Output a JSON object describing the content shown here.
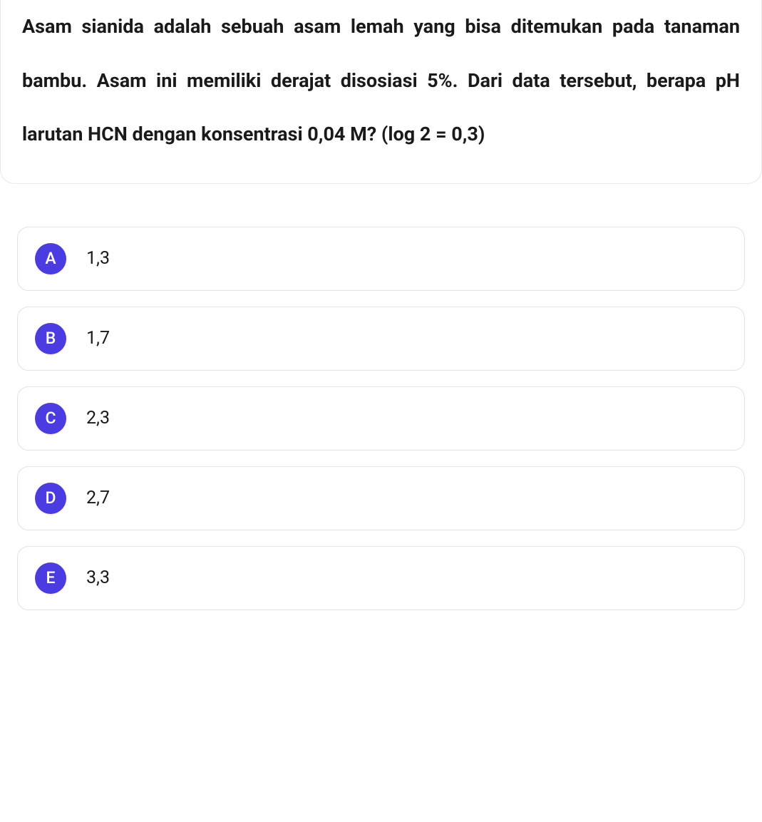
{
  "question": {
    "text": "Asam sianida adalah sebuah asam lemah yang bisa ditemukan pada tanaman bambu. Asam ini memiliki derajat disosiasi 5%. Dari data tersebut, berapa pH larutan HCN dengan konsentrasi 0,04 M? (log 2 = 0,3)"
  },
  "options": [
    {
      "letter": "A",
      "text": "1,3"
    },
    {
      "letter": "B",
      "text": "1,7"
    },
    {
      "letter": "C",
      "text": "2,3"
    },
    {
      "letter": "D",
      "text": "2,7"
    },
    {
      "letter": "E",
      "text": "3,3"
    }
  ]
}
